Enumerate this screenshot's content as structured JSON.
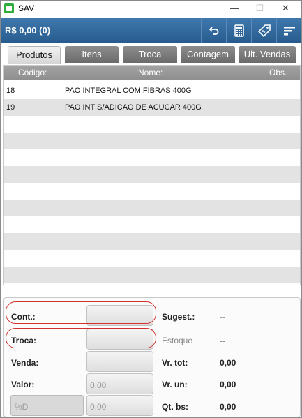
{
  "window": {
    "title": "SAV",
    "minimize": "—",
    "maximize": "☐",
    "close": "✕"
  },
  "toolbar": {
    "total": "R$ 0,00 (0)",
    "buttons": [
      "undo-icon",
      "calculator-icon",
      "price-tag-icon",
      "sort-icon"
    ]
  },
  "tabs": [
    {
      "label": "Produtos",
      "active": true
    },
    {
      "label": "Itens"
    },
    {
      "label": "Troca"
    },
    {
      "label": "Contagem"
    },
    {
      "label": "Ult. Vendas"
    }
  ],
  "grid": {
    "columns": [
      "Código:",
      "Nome:",
      "Obs."
    ],
    "rows": [
      {
        "codigo": "18",
        "nome": "PAO INTEGRAL COM FIBRAS 400G",
        "obs": ""
      },
      {
        "codigo": "19",
        "nome": "PAO INT S/ADICAO DE ACUCAR 400G",
        "obs": ""
      }
    ]
  },
  "form": {
    "cont_label": "Cont.:",
    "troca_label": "Troca:",
    "venda_label": "Venda:",
    "valor_label": "Valor:",
    "valor_value": "0,00",
    "pct_placeholder": "%D",
    "pct_value": "0,00",
    "sugest_label": "Sugest.:",
    "sugest_value": "--",
    "estoque_label": "Estoque",
    "estoque_value": "--",
    "vrtot_label": "Vr. tot:",
    "vrtot_value": "0,00",
    "vrun_label": "Vr. un:",
    "vrun_value": "0,00",
    "qtbs_label": "Qt. bs:",
    "qtbs_value": "0,00"
  },
  "colors": {
    "toolbar": "#285c8e",
    "highlight": "#d0312d",
    "row_alt": "#e3e3e3"
  }
}
